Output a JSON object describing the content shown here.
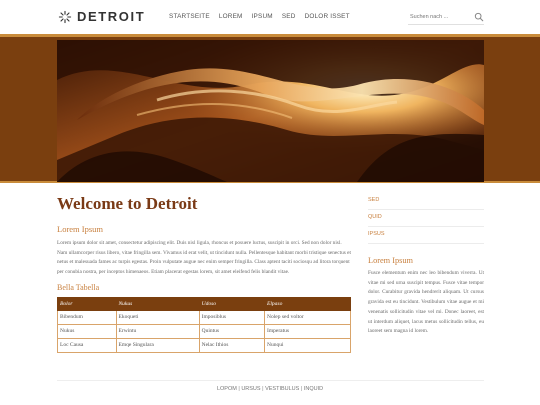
{
  "site": {
    "name": "DETROIT"
  },
  "nav": [
    "STARTSEITE",
    "LOREM",
    "IPSUM",
    "SED",
    "DOLOR ISSET"
  ],
  "search": {
    "placeholder": "Suchen nach ..."
  },
  "main": {
    "title": "Welcome to Detroit",
    "subtitle": "Lorem Ipsum",
    "intro": "Lorem ipsum dolor sit amet, consectetur adipiscing elit. Duis nisl ligula, rhoncus et posuere luctus, suscipit in orci. Sed non dolor nisl. Nam ullamcorper risus libero, vitae fringilla sem. Vivamus id erat velit, ut tincidunt nulla. Pellentesque habitant morbi tristique senectus et netus et malesuada fames ac turpis egestas. Proin vulputate augue nec enim semper fringilla. Class aptent taciti sociosqu ad litora torquent per conubia nostra, per inceptos himenaeos. Etiam placerat egestas lorem, sit amet eleifend felis blandit vitae.",
    "table_title": "Bella Tabella",
    "table": {
      "headers": [
        "Bolor",
        "Nukus",
        "Udoso",
        "Elpaso"
      ],
      "rows": [
        [
          "Bibendum",
          "Ekoqueti",
          "Imposiblus",
          "Nolep sed voltor"
        ],
        [
          "Nukus",
          "Erwintu",
          "Quintus",
          "Imperatus"
        ],
        [
          "Loc Causa",
          "Emqe Singulara",
          "Nelac Ithios",
          "Nunqui"
        ]
      ]
    }
  },
  "sidebar": {
    "links": [
      "SED",
      "QUID",
      "IPSUS"
    ],
    "heading": "Lorem Ipsum",
    "text": "Fusce elementum enim nec leo bibendum viverra. Ut vitae mi sed urna suscipit tempus. Fusce vitae tempor dolor. Curabitur gravida hendrerit aliquam. Ut cursus gravida est eu tincidunt. Vestibulum vitae augue et mi venenatis sollicitudin vitae vel mi. Donec laoreet, est ut interdum aliquet, lacus metus sollicitudin tellus, eu laoreet sem magna id lorem."
  },
  "footer": {
    "links": [
      "LOPOM",
      "URSUS",
      "VESTIBULUS",
      "INQUID"
    ]
  },
  "colors": {
    "brand_brown": "#7a3f0f",
    "accent_gold": "#c8803f",
    "title_brown": "#7a3a16"
  }
}
